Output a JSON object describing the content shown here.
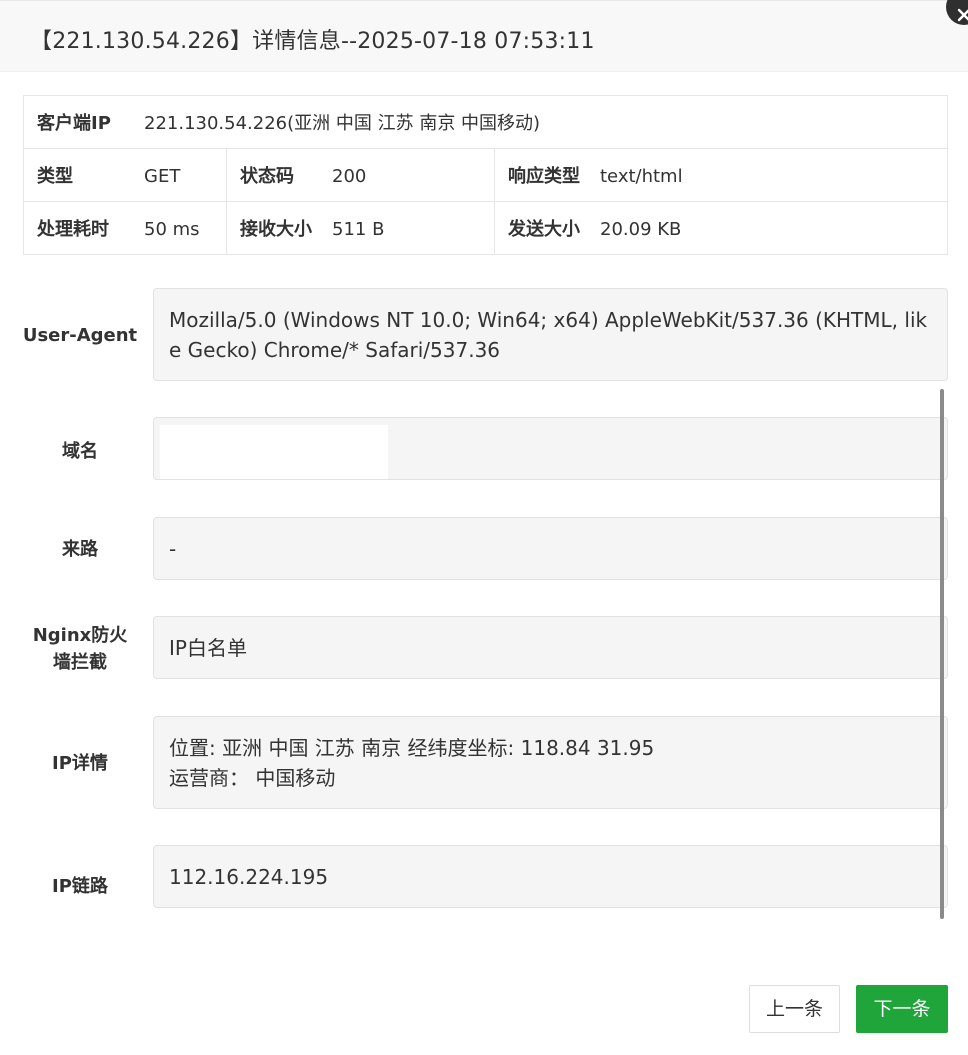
{
  "dialog": {
    "title": "【221.130.54.226】详情信息--2025-07-18 07:53:11"
  },
  "summary": {
    "client_ip_label": "客户端IP",
    "client_ip_value": "221.130.54.226(亚洲 中国 江苏 南京 中国移动)",
    "type_label": "类型",
    "type_value": "GET",
    "status_label": "状态码",
    "status_value": "200",
    "content_type_label": "响应类型",
    "content_type_value": "text/html",
    "duration_label": "处理耗时",
    "duration_value": "50 ms",
    "received_label": "接收大小",
    "received_value": "511 B",
    "sent_label": "发送大小",
    "sent_value": "20.09 KB"
  },
  "fields": {
    "user_agent_label": "User-Agent",
    "user_agent_value_line1": "Mozilla/5.0 (Windows NT 10.0; Win64; x64) AppleWebKit/537.36 (KHTML, lik",
    "user_agent_value_line2": "e Gecko) Chrome/* Safari/537.36",
    "domain_label": "域名",
    "domain_value": "",
    "referer_label": "来路",
    "referer_value": "-",
    "nginx_label_line1": "Nginx防火",
    "nginx_label_line2": "墙拦截",
    "nginx_value": "IP白名单",
    "ip_detail_label": "IP详情",
    "ip_detail_line1": "位置: 亚洲 中国 江苏 南京 经纬度坐标: 118.84 31.95",
    "ip_detail_line2": "运营商： 中国移动",
    "ip_chain_label": "IP链路",
    "ip_chain_value": "112.16.224.195"
  },
  "buttons": {
    "prev_label": "上一条",
    "next_label": "下一条"
  },
  "colors": {
    "accent_green": "#20a53a",
    "field_bg": "#f5f5f5",
    "title_bg": "#f8f8f8"
  },
  "icons": {
    "close": "close-icon"
  }
}
